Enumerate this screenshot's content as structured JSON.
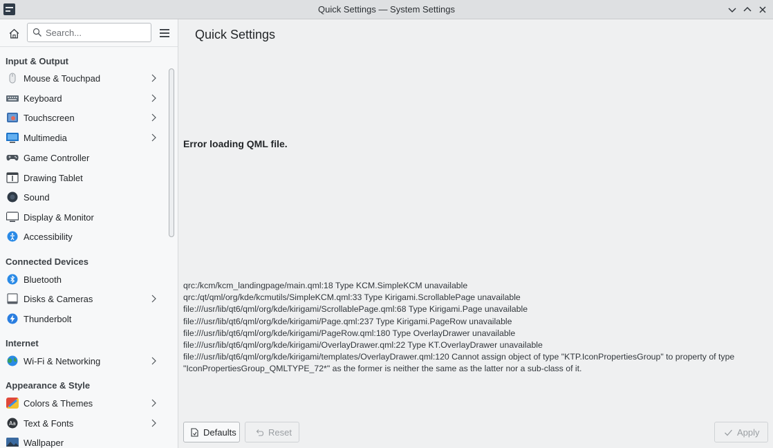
{
  "window": {
    "title": "Quick Settings — System Settings"
  },
  "sidebar": {
    "search_placeholder": "Search...",
    "sections": [
      {
        "title": "Input & Output"
      },
      {
        "title": "Connected Devices"
      },
      {
        "title": "Internet"
      },
      {
        "title": "Appearance & Style"
      }
    ],
    "items": [
      {
        "label": "Mouse & Touchpad",
        "icon": "mouse-icon",
        "color": "#e9ebed"
      },
      {
        "label": "Keyboard",
        "icon": "keyboard-icon",
        "color": "#5f6a75"
      },
      {
        "label": "Touchscreen",
        "icon": "touchscreen-icon",
        "color": "#3a6fb0"
      },
      {
        "label": "Multimedia",
        "icon": "multimedia-icon",
        "color": "#1c73c8"
      },
      {
        "label": "Game Controller",
        "icon": "gamepad-icon",
        "color": "#4a525a"
      },
      {
        "label": "Drawing Tablet",
        "icon": "tablet-icon",
        "color": "#3c4248"
      },
      {
        "label": "Sound",
        "icon": "sound-icon",
        "color": "#2f3a46"
      },
      {
        "label": "Display & Monitor",
        "icon": "monitor-icon",
        "color": "#3a4048"
      },
      {
        "label": "Accessibility",
        "icon": "accessibility-icon",
        "color": "#2a8ae6"
      },
      {
        "label": "Bluetooth",
        "icon": "bluetooth-icon",
        "color": "#2a8ae6"
      },
      {
        "label": "Disks & Cameras",
        "icon": "disk-icon",
        "color": "#5a6068"
      },
      {
        "label": "Thunderbolt",
        "icon": "thunderbolt-icon",
        "color": "#2a7ee0"
      },
      {
        "label": "Wi-Fi & Networking",
        "icon": "network-icon",
        "color": "#3aa05a"
      },
      {
        "label": "Colors & Themes",
        "icon": "colors-icon",
        "color": "#e0483a"
      },
      {
        "label": "Text & Fonts",
        "icon": "fonts-icon",
        "color": "#31363b"
      },
      {
        "label": "Wallpaper",
        "icon": "wallpaper-icon",
        "color": "#3a6aa0"
      }
    ]
  },
  "main": {
    "title": "Quick Settings",
    "error_heading": "Error loading QML file.",
    "error_lines": [
      "qrc:/kcm/kcm_landingpage/main.qml:18 Type KCM.SimpleKCM unavailable",
      "qrc:/qt/qml/org/kde/kcmutils/SimpleKCM.qml:33 Type Kirigami.ScrollablePage unavailable",
      "file:///usr/lib/qt6/qml/org/kde/kirigami/ScrollablePage.qml:68 Type Kirigami.Page unavailable",
      "file:///usr/lib/qt6/qml/org/kde/kirigami/Page.qml:237 Type Kirigami.PageRow unavailable",
      "file:///usr/lib/qt6/qml/org/kde/kirigami/PageRow.qml:180 Type OverlayDrawer unavailable",
      "file:///usr/lib/qt6/qml/org/kde/kirigami/OverlayDrawer.qml:22 Type KT.OverlayDrawer unavailable",
      "file:///usr/lib/qt6/qml/org/kde/kirigami/templates/OverlayDrawer.qml:120 Cannot assign object of type \"KTP.IconPropertiesGroup\" to property of type \"IconPropertiesGroup_QMLTYPE_72*\" as the former is neither the same as the latter nor a sub-class of it."
    ],
    "buttons": {
      "defaults": "Defaults",
      "reset": "Reset",
      "apply": "Apply"
    }
  }
}
